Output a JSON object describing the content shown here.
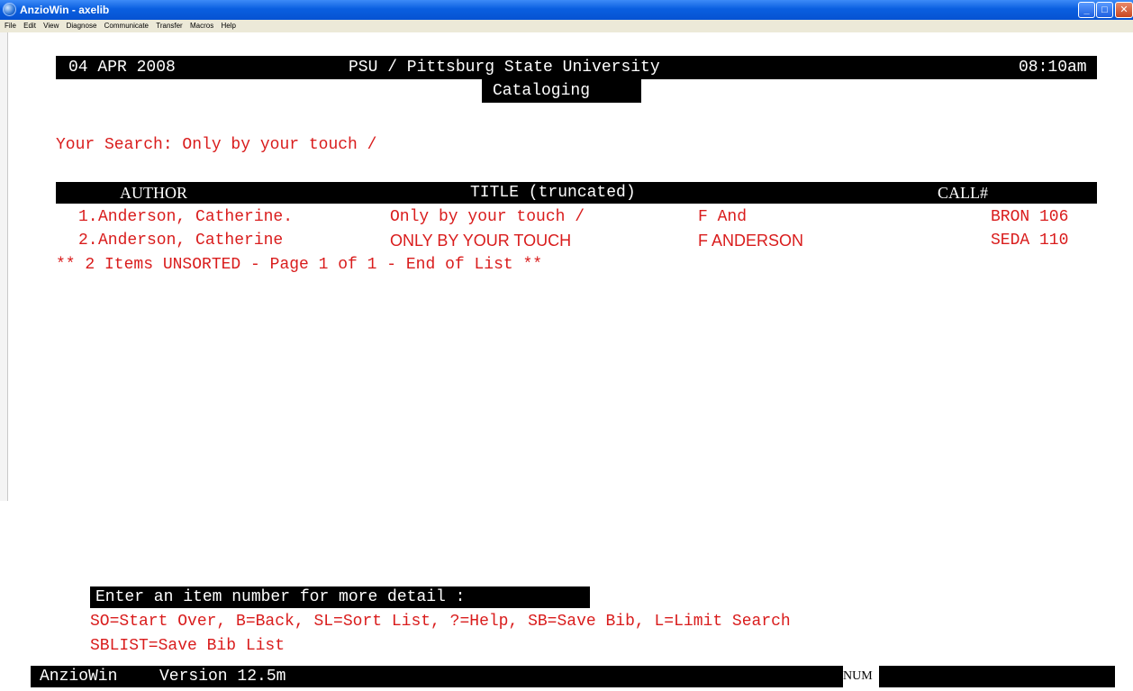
{
  "window": {
    "title": "AnzioWin - axelib",
    "minimize_glyph": "_",
    "maximize_glyph": "□",
    "close_glyph": "✕"
  },
  "menu": [
    "File",
    "Edit",
    "View",
    "Diagnose",
    "Communicate",
    "Transfer",
    "Macros",
    "Help"
  ],
  "header": {
    "date": "04 APR 2008",
    "institution": "PSU / Pittsburg State University",
    "time": "08:10am",
    "module": "Cataloging"
  },
  "search": {
    "text": "Your Search: Only by your touch /"
  },
  "results": {
    "columns": {
      "author": "AUTHOR",
      "title": "TITLE (truncated)",
      "call": "CALL#"
    },
    "rows": [
      {
        "num": "1.",
        "author": "Anderson, Catherine.",
        "title": "Only by your touch /",
        "call": "F And",
        "location": "BRON 106"
      },
      {
        "num": "2.",
        "author": "Anderson, Catherine",
        "title": "ONLY BY YOUR TOUCH",
        "call": "F ANDERSON",
        "location": "SEDA 110"
      }
    ],
    "summary": "** 2 Items UNSORTED - Page 1 of 1 - End of List **"
  },
  "prompt": {
    "text": "Enter an item number for more detail :",
    "options_line1": "SO=Start Over, B=Back, SL=Sort List, ?=Help, SB=Save Bib, L=Limit Search",
    "options_line2": "SBLIST=Save Bib List"
  },
  "status": {
    "app": "AnzioWin",
    "version": "Version 12.5m",
    "num": "NUM"
  },
  "colors": {
    "terminal_text": "#d91c1c",
    "inverse_bg": "#000000",
    "inverse_text": "#ffffff"
  }
}
